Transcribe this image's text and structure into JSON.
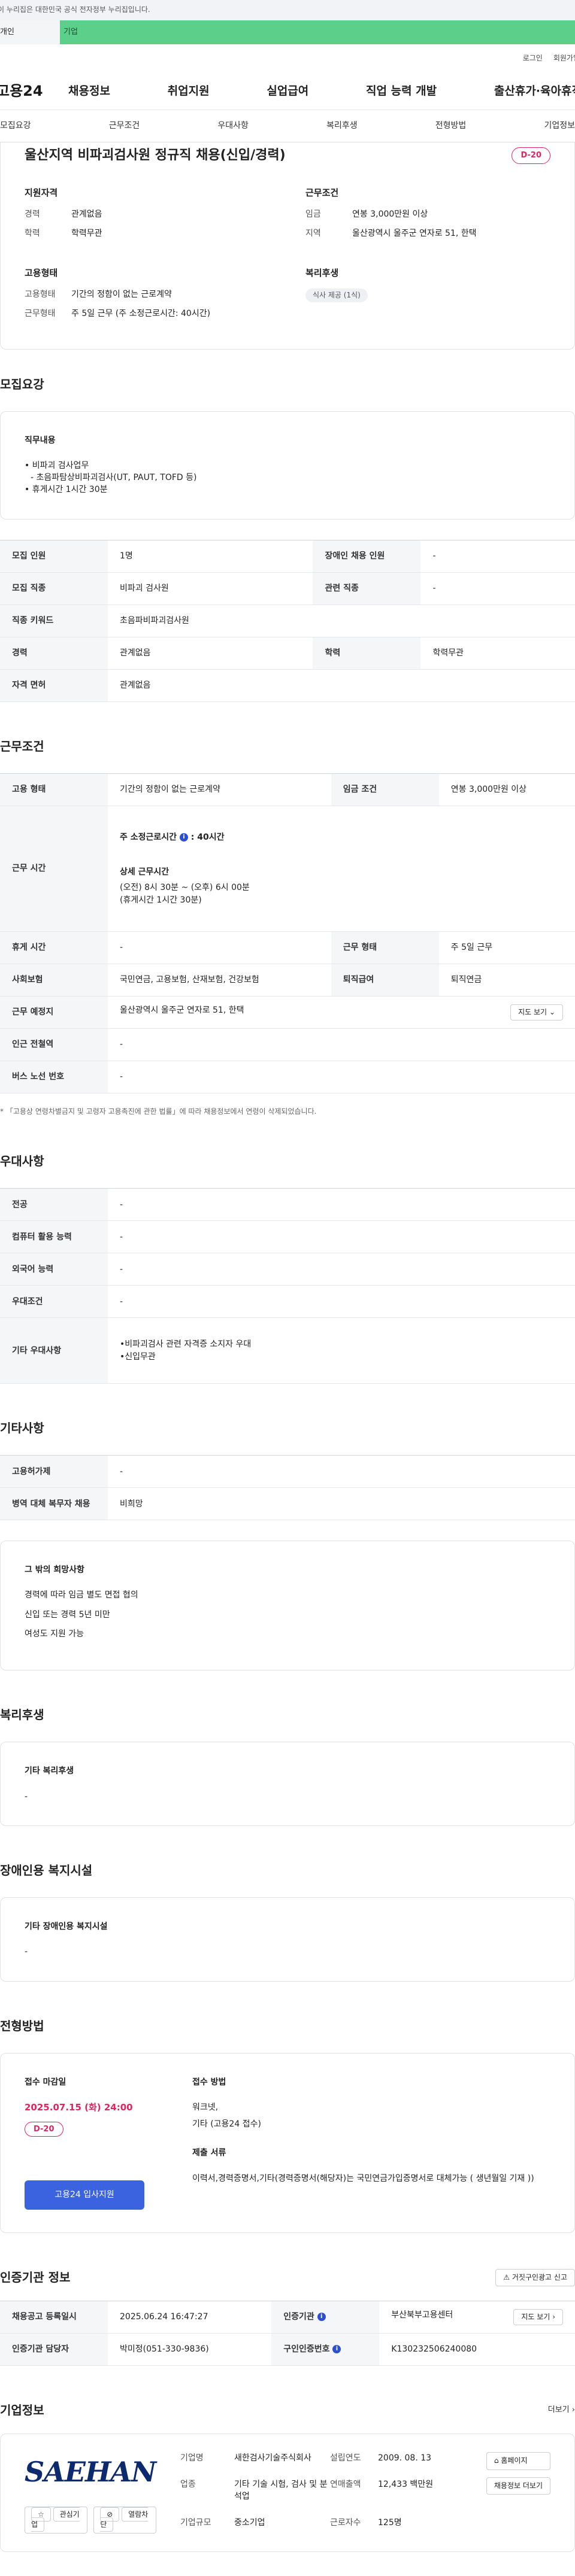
{
  "banner": {
    "gov_text": "이 누리집은 대한민국 공식 전자정부 누리집입니다.",
    "left": "개인",
    "right": "기업"
  },
  "util": {
    "login": "로그인",
    "signup": "회원가입"
  },
  "gnb": {
    "logo": "고용24",
    "menu": [
      "채용정보",
      "취업지원",
      "실업급여",
      "직업 능력 개발",
      "출산휴가·육아휴직"
    ]
  },
  "tabs": [
    "모집요강",
    "근무조건",
    "우대사항",
    "복리후생",
    "전형방법",
    "기업정보"
  ],
  "summary": {
    "title": "울산지역 비파괴검사원 정규직 채용(신입/경력)",
    "dday": "D-20",
    "qual_title": "지원자격",
    "qual": [
      {
        "k": "경력",
        "v": "관계없음"
      },
      {
        "k": "학력",
        "v": "학력무관"
      }
    ],
    "cond_title": "근무조건",
    "cond": [
      {
        "k": "임금",
        "v": "연봉 3,000만원 이상"
      },
      {
        "k": "지역",
        "v": "울산광역시 울주군 연자로 51, 한택"
      }
    ],
    "emp_title": "고용형태",
    "emp": [
      {
        "k": "고용형태",
        "v": "기간의 정함이 없는 근로계약"
      },
      {
        "k": "근무형태",
        "v": "주 5일 근무 (주 소정근로시간: 40시간)"
      }
    ],
    "welfare_title": "복리후생",
    "welfare_chip": "식사 제공 (1식)"
  },
  "recruit": {
    "title": "모집요강",
    "duty_title": "직무내용",
    "duty_lines": [
      "• 비파괴 검사업무",
      "  - 초음파탐상비파괴검사(UT, PAUT, TOFD 등)",
      "• 휴게시간 1시간 30분"
    ],
    "rows": [
      [
        "모집 인원",
        "1명",
        "장애인 채용 인원",
        "-"
      ],
      [
        "모집 직종",
        "비파괴 검사원",
        "관련 직종",
        "-"
      ],
      [
        "직종 키워드",
        "초음파비파괴검사원",
        "",
        ""
      ],
      [
        "경력",
        "관계없음",
        "학력",
        "학력무관"
      ],
      [
        "자격 면허",
        "관계없음",
        "",
        ""
      ]
    ]
  },
  "work": {
    "title": "근무조건",
    "emp_k": "고용 형태",
    "emp_v": "기간의 정함이 없는 근로계약",
    "wage_k": "임금 조건",
    "wage_v": "연봉 3,000만원 이상",
    "time_k": "근무 시간",
    "time_main": "주 소정근로시간",
    "time_hours": "40시간",
    "time_detail_title": "상세 근무시간",
    "time_detail_1": "(오전) 8시 30분 ~ (오후) 6시 00분",
    "time_detail_2": "(휴게시간 1시간 30분)",
    "rest_k": "휴게 시간",
    "rest_v": "-",
    "form_k": "근무 형태",
    "form_v": "주 5일 근무",
    "ins_k": "사회보험",
    "ins_v": "국민연금, 고용보험, 산재보험, 건강보험",
    "sev_k": "퇴직급여",
    "sev_v": "퇴직연금",
    "loc_k": "근무 예정지",
    "loc_v": "울산광역시 울주군 연자로 51, 한택",
    "map_btn": "지도 보기",
    "subway_k": "인근 전철역",
    "subway_v": "-",
    "bus_k": "버스 노선 번호",
    "bus_v": "-",
    "note": "* 「고용상 연령차별금지 및 고령자 고용촉진에 관한 법률」에 따라 채용정보에서 연령이 삭제되었습니다."
  },
  "pref": {
    "title": "우대사항",
    "rows": [
      [
        "전공",
        "-"
      ],
      [
        "컴퓨터 활용 능력",
        "-"
      ],
      [
        "외국어 능력",
        "-"
      ],
      [
        "우대조건",
        "-"
      ]
    ],
    "etc_k": "기타 우대사항",
    "etc_1": "•비파괴검사 관련 자격증 소지자 우대",
    "etc_2": "•신입무관"
  },
  "other": {
    "title": "기타사항",
    "rows": [
      [
        "고용허가제",
        "-"
      ],
      [
        "병역 대체 복무자 채용",
        "비희망"
      ]
    ],
    "box_title": "그 밖의 희망사항",
    "box_lines": [
      "경력에 따라 임금 별도 면접 협의",
      "신입 또는 경력 5년 미만",
      "여성도 지원 가능"
    ]
  },
  "welfare": {
    "title": "복리후생",
    "box_title": "기타 복리후생",
    "box_v": "-"
  },
  "disabled": {
    "title": "장애인용 복지시설",
    "box_title": "기타 장애인용 복지시설",
    "box_v": "-"
  },
  "process": {
    "title": "전형방법",
    "deadline_title": "접수 마감일",
    "deadline": "2025.07.15 (화) 24:00",
    "dday": "D-20",
    "apply_btn": "고용24 입사지원",
    "method_title": "접수 방법",
    "method_1": "워크넷,",
    "method_2": "기타 (고용24 접수)",
    "docs_title": "제출 서류",
    "docs": "이력서,경력증명서,기타(경력증명서(해당자)는 국민연금가입증명서로 대체가능 ( 생년월일 기재 ))"
  },
  "agency": {
    "title": "인증기관 정보",
    "report_btn": "거짓구인광고 신고",
    "reg_k": "채용공고 등록일시",
    "reg_v": "2025.06.24 16:47:27",
    "org_k": "인증기관",
    "org_v": "부산북부고용센터",
    "map_btn": "지도 보기",
    "mgr_k": "인증기관 담당자",
    "mgr_v": "박미정(051-330-9836)",
    "num_k": "구인인증번호",
    "num_v": "K130232506240080"
  },
  "company": {
    "title": "기업정보",
    "more": "더보기",
    "logo": "SAEHAN",
    "fav_btn": "관심기업",
    "block_btn": "열람차단",
    "name_k": "기업명",
    "name_v": "새한검사기술주식회사",
    "est_k": "설립연도",
    "est_v": "2009. 08. 13",
    "ind_k": "업종",
    "ind_v": "기타 기술 시험, 검사 및 분석업",
    "sales_k": "연매출액",
    "sales_v": "12,433 백만원",
    "emp_k": "근로자수",
    "emp_v": "125명",
    "size_k": "기업규모",
    "size_v": "중소기업",
    "home_btn": "홈페이지",
    "list_btn": "채용정보 더보기"
  }
}
